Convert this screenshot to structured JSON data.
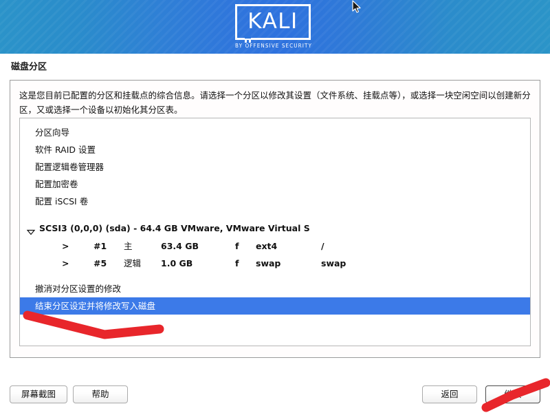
{
  "banner": {
    "logo_text": "KALI",
    "logo_subtitle": "BY OFFENSIVE SECURITY",
    "colors": {
      "left": "#2b93c9",
      "center": "#2e72de",
      "right": "#2b94c8"
    }
  },
  "page": {
    "title": "磁盘分区",
    "description": "这是您目前已配置的分区和挂载点的综合信息。请选择一个分区以修改其设置（文件系统、挂载点等），或选择一块空闲空间以创建新分区，又或选择一个设备以初始化其分区表。"
  },
  "list": {
    "top_actions": [
      {
        "label": "分区向导"
      },
      {
        "label": "软件 RAID 设置"
      },
      {
        "label": "配置逻辑卷管理器"
      },
      {
        "label": "配置加密卷"
      },
      {
        "label": "配置 iSCSI 卷"
      }
    ],
    "disk": {
      "expander_icon": "triangle-down-icon",
      "label": "SCSI3 (0,0,0) (sda) - 64.4 GB VMware, VMware Virtual S",
      "partitions": [
        {
          "marker": ">",
          "number": "#1",
          "type": "主",
          "size": "63.4 GB",
          "flags": "f",
          "filesystem": "ext4",
          "mountpoint": "/"
        },
        {
          "marker": ">",
          "number": "#5",
          "type": "逻辑",
          "size": "1.0 GB",
          "flags": "f",
          "filesystem": "swap",
          "mountpoint": "swap"
        }
      ]
    },
    "bottom_actions": [
      {
        "label": "撤消对分区设置的修改",
        "selected": false
      },
      {
        "label": "结束分区设定并将修改写入磁盘",
        "selected": true
      }
    ],
    "selection_color": "#3c7ae8"
  },
  "footer": {
    "screenshot_label": "屏幕截图",
    "help_label": "帮助",
    "back_label": "返回",
    "continue_label": "继续"
  },
  "annotations": {
    "color": "#e8262b",
    "marks": [
      {
        "name": "arrow-pointing-to-selected-item"
      },
      {
        "name": "arrow-pointing-to-continue-button"
      }
    ]
  }
}
